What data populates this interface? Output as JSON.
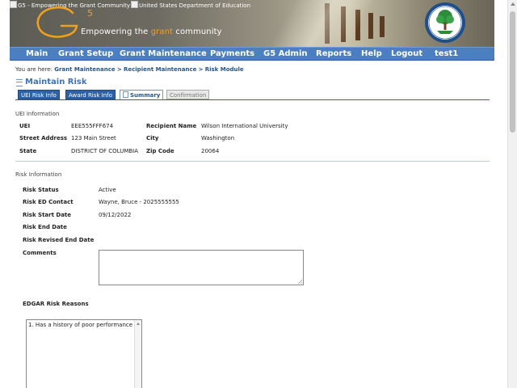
{
  "header": {
    "logo_alt": "G5 - Empowering the Grant Community",
    "seal_alt": "United States Department of Education",
    "tagline_pre": "Empowering the ",
    "tagline_grant": "grant",
    "tagline_post": " community",
    "logo_digit": "5"
  },
  "nav": {
    "items": [
      "Main",
      "Grant Setup",
      "Grant Maintenance",
      "Payments",
      "G5 Admin",
      "Reports",
      "Help",
      "Logout",
      "test1"
    ]
  },
  "breadcrumb": {
    "prefix": "You are here:",
    "items": [
      "Grant Maintenance",
      "Recipient Maintenance",
      "Risk Module"
    ],
    "separator": ">"
  },
  "page_title": "Maintain Risk",
  "tabs": [
    {
      "label": "UEI Risk Info",
      "state": "blue"
    },
    {
      "label": "Award Risk Info",
      "state": "blue"
    },
    {
      "label": "Summary",
      "state": "active"
    },
    {
      "label": "Confirmation",
      "state": "disabled"
    }
  ],
  "uei_section": {
    "heading": "UEI Information",
    "uei_label": "UEI",
    "uei_value": "EEE555FFF674",
    "recipient_label": "Recipient Name",
    "recipient_value": "Wilson International University",
    "street_label": "Street Address",
    "street_value": "123 Main Street",
    "city_label": "City",
    "city_value": "Washington",
    "state_label": "State",
    "state_value": "DISTRICT OF COLUMBIA",
    "zip_label": "Zip Code",
    "zip_value": "20064"
  },
  "risk_section": {
    "heading": "Risk Information",
    "status_label": "Risk Status",
    "status_value": "Active",
    "contact_label": "Risk ED Contact",
    "contact_value": "Wayne, Bruce - 2025555555",
    "start_label": "Risk Start Date",
    "start_value": "09/12/2022",
    "end_label": "Risk End Date",
    "end_value": "",
    "revised_label": "Risk Revised End Date",
    "revised_value": "",
    "comments_label": "Comments",
    "comments_value": "",
    "edgar_label": "EDGAR Risk Reasons",
    "edgar_options": [
      "1. Has a history of poor performance"
    ]
  },
  "colors": {
    "nav_bg": "#4a7fc1",
    "title": "#3d74b7",
    "link": "#23558f",
    "tab_blue": "#2d62a8",
    "tagline_accent": "#f0a020"
  }
}
